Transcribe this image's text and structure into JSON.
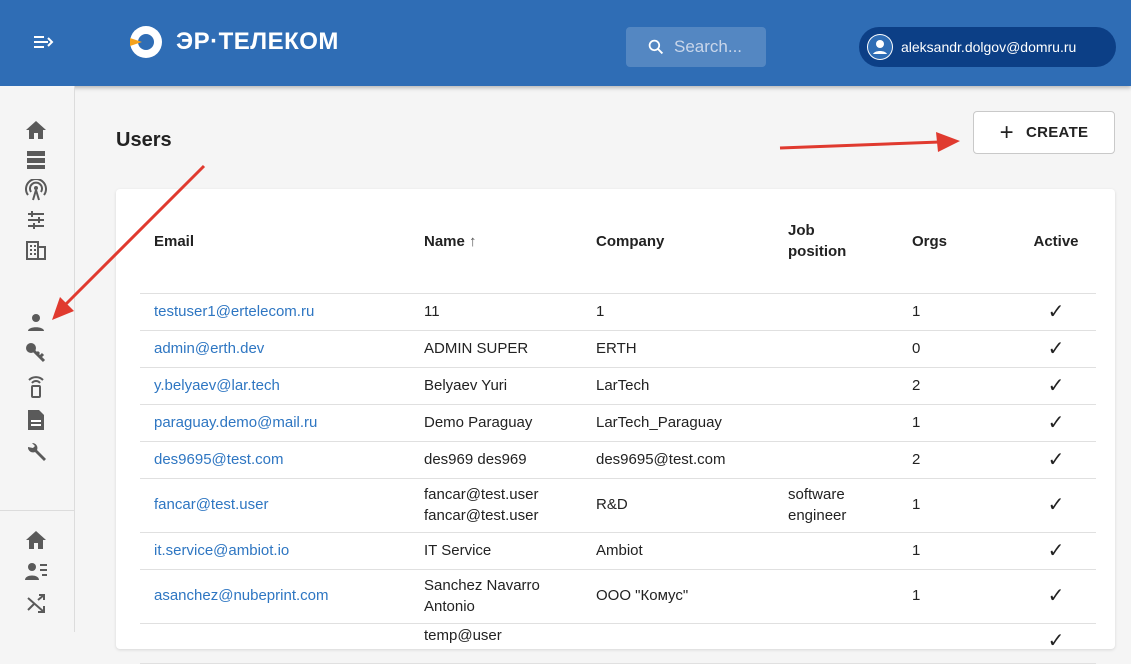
{
  "header": {
    "brand": "ЭР·ТЕЛЕКОМ",
    "search_placeholder": "Search...",
    "user_email": "aleksandr.dolgov@domru.ru"
  },
  "page": {
    "title": "Users",
    "create_label": "CREATE"
  },
  "table": {
    "columns": {
      "email": "Email",
      "name": "Name",
      "sort_indicator": "↑",
      "company": "Company",
      "job_position": "Job position",
      "orgs": "Orgs",
      "active": "Active"
    },
    "rows": [
      {
        "email": "testuser1@ertelecom.ru",
        "name": "11",
        "company": "1",
        "job": "",
        "orgs": "1",
        "active": "✓"
      },
      {
        "email": "admin@erth.dev",
        "name": "ADMIN SUPER",
        "company": "ERTH",
        "job": "",
        "orgs": "0",
        "active": "✓"
      },
      {
        "email": "y.belyaev@lar.tech",
        "name": "Belyaev Yuri",
        "company": "LarTech",
        "job": "",
        "orgs": "2",
        "active": "✓"
      },
      {
        "email": "paraguay.demo@mail.ru",
        "name": "Demo Paraguay",
        "company": "LarTech_Paraguay",
        "job": "",
        "orgs": "1",
        "active": "✓"
      },
      {
        "email": "des9695@test.com",
        "name": "des969 des969",
        "company": "des9695@test.com",
        "job": "",
        "orgs": "2",
        "active": "✓"
      },
      {
        "email": "fancar@test.user",
        "name": "fancar@test.user fancar@test.user",
        "company": "R&D",
        "job": "software engineer",
        "orgs": "1",
        "active": "✓"
      },
      {
        "email": "it.service@ambiot.io",
        "name": "IT Service",
        "company": "Ambiot",
        "job": "",
        "orgs": "1",
        "active": "✓"
      },
      {
        "email": "asanchez@nubeprint.com",
        "name": "Sanchez Navarro Antonio",
        "company": "ООО \"Комус\"",
        "job": "",
        "orgs": "1",
        "active": "✓"
      },
      {
        "email": "",
        "name": "temp@user",
        "company": "",
        "job": "",
        "orgs": "",
        "active": "✓"
      }
    ]
  },
  "sidebar": {
    "icons": [
      "home-icon",
      "storage-icon",
      "antenna-icon",
      "tune-icon",
      "building-icon",
      "person-icon",
      "key-icon",
      "router-icon",
      "document-icon",
      "wrench-icon",
      "home-icon",
      "person-list-icon",
      "shuffle-icon"
    ]
  },
  "colors": {
    "appbar": "#2f6db5",
    "user_chip": "#0c3f86",
    "link": "#2e76c2",
    "annotation_arrow": "#e03a2f"
  }
}
